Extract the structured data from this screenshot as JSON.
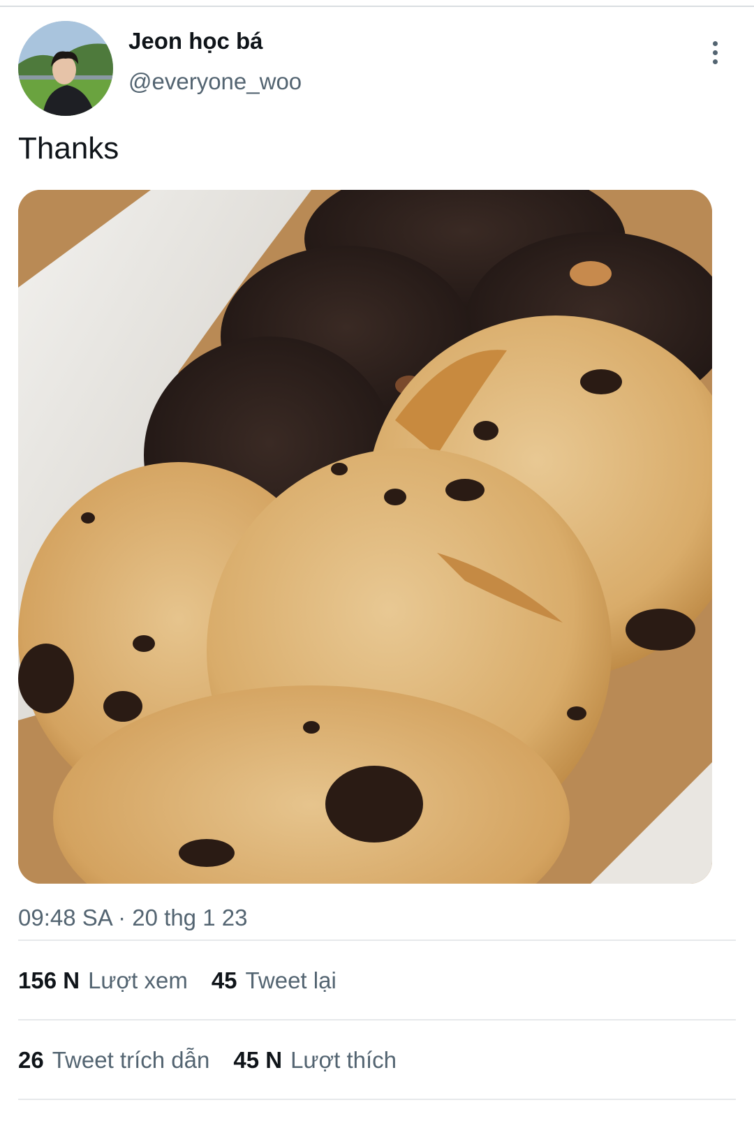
{
  "author": {
    "display_name": "Jeon học bá",
    "handle": "@everyone_woo"
  },
  "menu": {
    "icon": "more-vertical-icon"
  },
  "tweet": {
    "text": "Thanks",
    "timestamp": "09:48 SA · 20 thg 1 23"
  },
  "stats": {
    "views": {
      "count": "156 N",
      "label": "Lượt xem"
    },
    "retweets": {
      "count": "45",
      "label": "Tweet lại"
    },
    "quote_tweets": {
      "count": "26",
      "label": "Tweet trích dẫn"
    },
    "likes": {
      "count": "45 N",
      "label": "Lượt thích"
    }
  },
  "colors": {
    "text_primary": "#0f1419",
    "text_secondary": "#536471",
    "divider": "#e6e9eb"
  }
}
